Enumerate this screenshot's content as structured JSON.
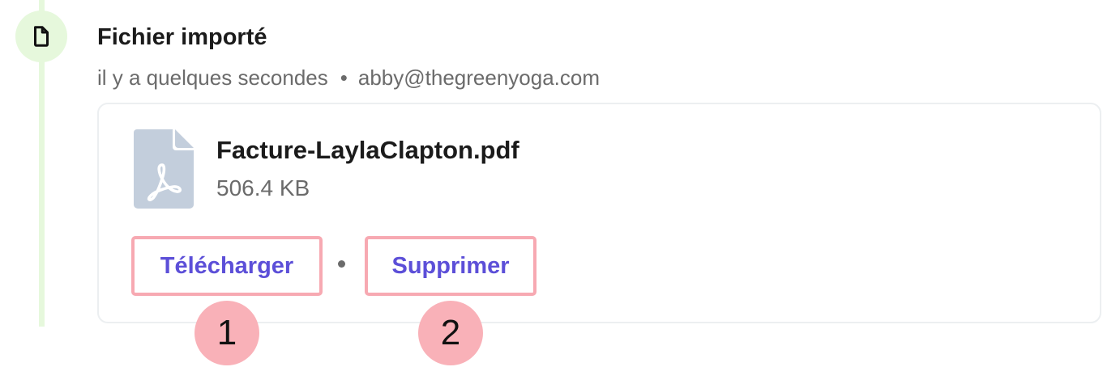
{
  "event": {
    "icon": "document-icon",
    "title": "Fichier importé",
    "time": "il y a quelques secondes",
    "separator": "•",
    "user": "abby@thegreenyoga.com"
  },
  "attachment": {
    "icon": "pdf-file-icon",
    "file_name": "Facture-LaylaClapton.pdf",
    "file_size": "506.4 KB",
    "actions": {
      "download_label": "Télécharger",
      "delete_label": "Supprimer"
    }
  },
  "markers": [
    "1",
    "2"
  ],
  "colors": {
    "timeline": "#e6f8dc",
    "link": "#5c4fd8",
    "highlight": "#f7a9b2",
    "marker": "#f9b1b8",
    "pdf_icon": "#c3cedc"
  }
}
